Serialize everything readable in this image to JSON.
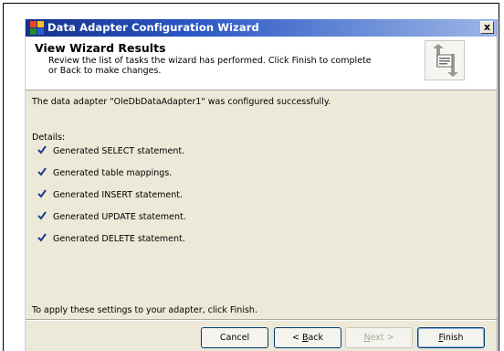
{
  "window": {
    "title": "Data Adapter Configuration Wizard",
    "close_label": "x"
  },
  "header": {
    "title": "View Wizard Results",
    "description": "Review the list of tasks the wizard has performed. Click Finish to complete or Back to make changes."
  },
  "body": {
    "success_message": "The data adapter \"OleDbDataAdapter1\" was configured successfully.",
    "details_label": "Details:",
    "items": [
      "Generated SELECT statement.",
      "Generated table mappings.",
      "Generated INSERT statement.",
      "Generated UPDATE statement.",
      "Generated DELETE statement."
    ],
    "footer_message": "To apply these settings to your adapter, click Finish."
  },
  "buttons": {
    "cancel": "Cancel",
    "back_prefix": "< ",
    "back_mnemonic": "B",
    "back_rest": "ack",
    "next_mnemonic": "N",
    "next_rest": "ext >",
    "finish_mnemonic": "F",
    "finish_rest": "inish"
  },
  "colors": {
    "titlebar_start": "#16318c",
    "titlebar_end": "#9cb6e6",
    "dialog_bg": "#ece9d8",
    "check": "#1c3a8c"
  },
  "icons": {
    "window_icon": "wizard-app-icon",
    "header_icon": "refresh-document-icon",
    "check": "checkmark-icon"
  }
}
